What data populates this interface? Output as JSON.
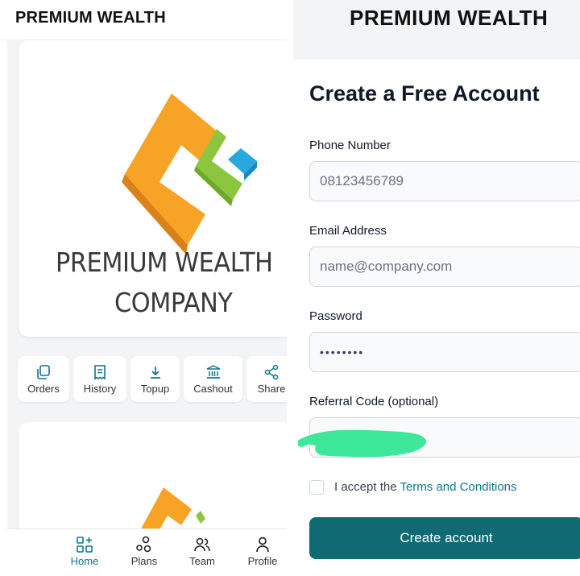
{
  "left": {
    "header_title": "PREMIUM WEALTH",
    "logo": {
      "line1": "PREMIUM WEALTH",
      "line2": "COMPANY"
    },
    "actions": [
      {
        "label": "Orders",
        "icon": "orders-icon"
      },
      {
        "label": "History",
        "icon": "history-icon"
      },
      {
        "label": "Topup",
        "icon": "download-icon"
      },
      {
        "label": "Cashout",
        "icon": "bank-icon"
      },
      {
        "label": "Share",
        "icon": "share-icon"
      }
    ],
    "nav": [
      {
        "label": "Home",
        "icon": "grid-plus-icon",
        "active": true
      },
      {
        "label": "Plans",
        "icon": "plans-icon"
      },
      {
        "label": "Team",
        "icon": "team-icon"
      },
      {
        "label": "Profile",
        "icon": "user-icon"
      }
    ]
  },
  "right": {
    "header_title": "PREMIUM WEALTH",
    "form_title": "Create a Free Account",
    "phone": {
      "label": "Phone Number",
      "placeholder": "08123456789"
    },
    "email": {
      "label": "Email Address",
      "placeholder": "name@company.com"
    },
    "password": {
      "label": "Password",
      "value": "••••••••"
    },
    "referral": {
      "label": "Referral Code (optional)",
      "value": ""
    },
    "accept_text": "I accept the ",
    "terms_link": "Terms and Conditions",
    "submit_label": "Create account"
  },
  "colors": {
    "accent": "#0f6a73",
    "link": "#0e7490",
    "logo_orange": "#f7a325",
    "logo_green": "#8cc63f",
    "logo_blue": "#29a8e0"
  }
}
